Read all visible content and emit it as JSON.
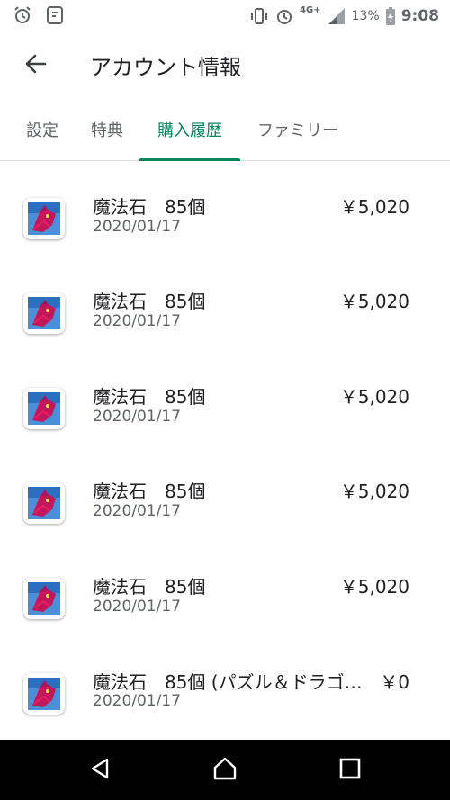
{
  "status_bar": {
    "network": "4G+",
    "battery": "13%",
    "time": "9:08"
  },
  "app_bar": {
    "title": "アカウント情報"
  },
  "tabs": [
    {
      "label": "設定"
    },
    {
      "label": "特典"
    },
    {
      "label": "購入履歴",
      "active": true
    },
    {
      "label": "ファミリー"
    }
  ],
  "purchases": [
    {
      "title": "魔法石　85個",
      "date": "2020/01/17",
      "price": "￥5,020"
    },
    {
      "title": "魔法石　85個",
      "date": "2020/01/17",
      "price": "￥5,020"
    },
    {
      "title": "魔法石　85個",
      "date": "2020/01/17",
      "price": "￥5,020"
    },
    {
      "title": "魔法石　85個",
      "date": "2020/01/17",
      "price": "￥5,020"
    },
    {
      "title": "魔法石　85個",
      "date": "2020/01/17",
      "price": "￥5,020"
    },
    {
      "title": "魔法石　85個 (パズル＆ドラゴ…",
      "date": "2020/01/17",
      "price": "￥0"
    }
  ],
  "colors": {
    "accent": "#01875f",
    "text_primary": "#202124",
    "text_secondary": "#5f6368",
    "nav_background": "#000000"
  },
  "icons": {
    "status_left": [
      "alarm-clock-icon",
      "notification-app-icon"
    ],
    "status_right": [
      "vibrate-icon",
      "alarm-icon",
      "signal-icon",
      "battery-icon"
    ],
    "app_bar": "back-arrow-icon",
    "navigation": [
      "back-triangle-icon",
      "home-icon",
      "recents-icon"
    ],
    "list_item": "app-thumbnail-icon"
  }
}
